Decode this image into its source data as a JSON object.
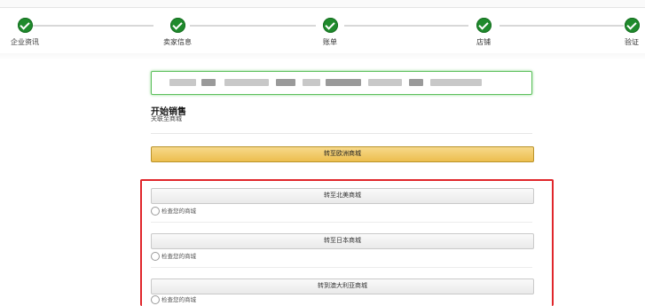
{
  "steps": [
    {
      "label": "企业资讯"
    },
    {
      "label": "卖家信息"
    },
    {
      "label": "账单"
    },
    {
      "label": "店铺"
    },
    {
      "label": "验证"
    }
  ],
  "section": {
    "title": "开始销售",
    "subtitle": "关联至商城"
  },
  "primary_button": {
    "label": "转至欧洲商城"
  },
  "marketplaces": [
    {
      "button": "转至北美商城",
      "radio_label": "检查您的商城"
    },
    {
      "button": "转至日本商城",
      "radio_label": "检查您的商城"
    },
    {
      "button": "转到澳大利亚商城",
      "radio_label": "检查您的商城"
    }
  ],
  "colors": {
    "step_done": "#1f8a2c",
    "primary_button": "#ecbe4e",
    "highlight_frame": "#e0262b",
    "url_box_border": "#5cc05c"
  }
}
